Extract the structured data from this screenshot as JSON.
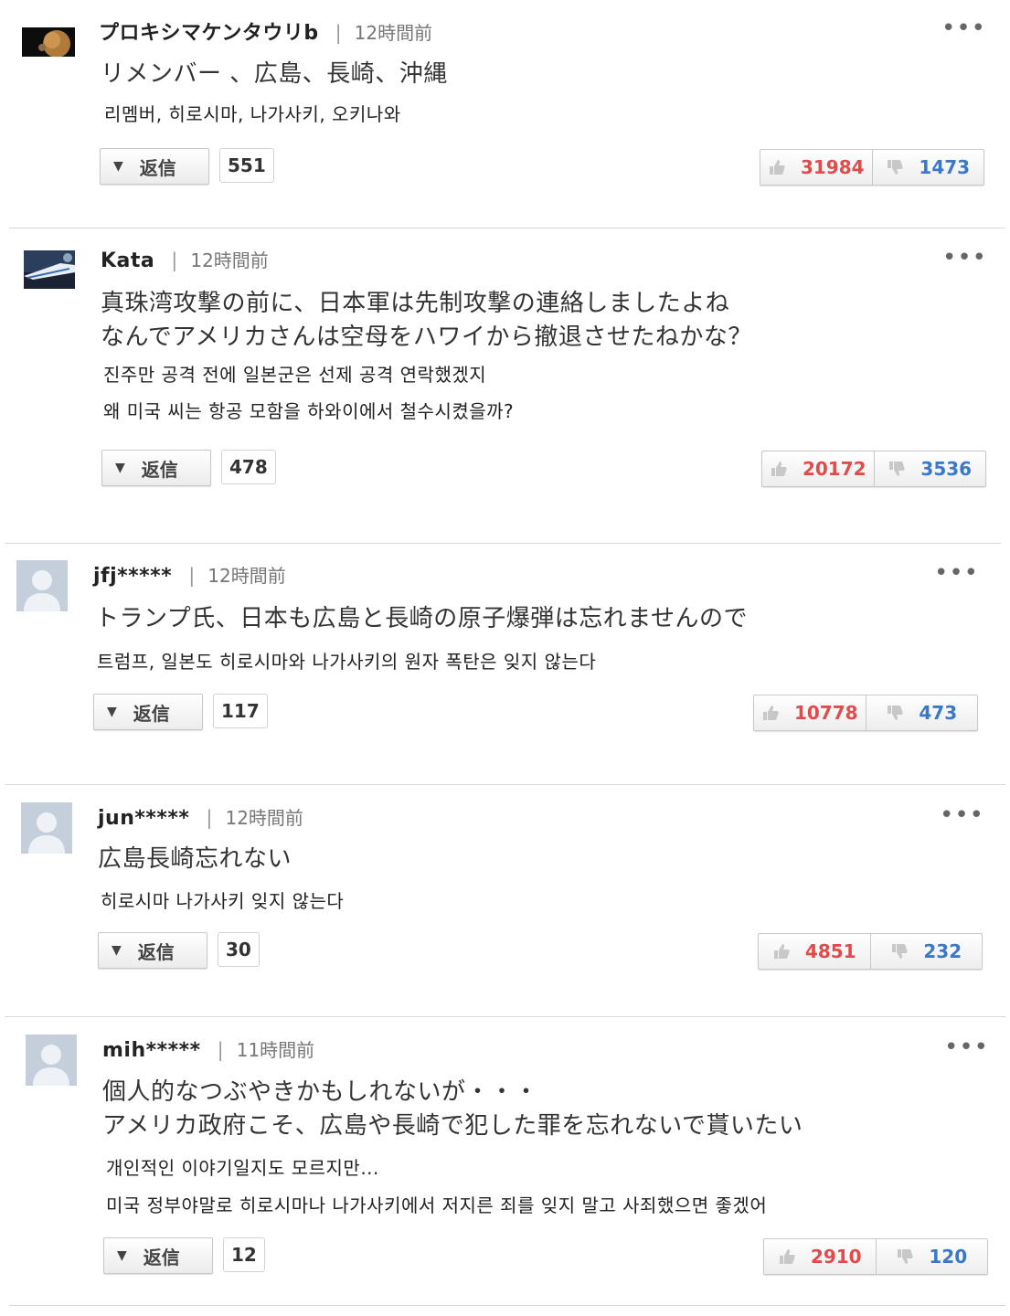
{
  "reply_label": "返信",
  "colors": {
    "like": "#e14b4b",
    "dislike": "#3a78c8",
    "divider": "#d8d8d8"
  },
  "comments": [
    {
      "username": "プロキシマケンタウリb",
      "time": "12時間前",
      "avatar_icon": "planet-avatar-icon",
      "text_jp": [
        "リメンバー 、広島、長崎、沖縄"
      ],
      "text_ko": [
        "리멤버, 히로시마, 나가사키, 오키나와"
      ],
      "reply_count": "551",
      "likes": "31984",
      "dislikes": "1473"
    },
    {
      "username": "Kata",
      "time": "12時間前",
      "avatar_icon": "train-avatar-icon",
      "text_jp": [
        "真珠湾攻撃の前に、日本軍は先制攻撃の連絡しましたよね",
        "なんでアメリカさんは空母をハワイから撤退させたねかな？"
      ],
      "text_ko": [
        "진주만 공격 전에 일본군은 선제 공격 연락했겠지",
        "왜 미국 씨는 항공 모함을 하와이에서 철수시켰을까?"
      ],
      "reply_count": "478",
      "likes": "20172",
      "dislikes": "3536"
    },
    {
      "username": "jfj*****",
      "time": "12時間前",
      "avatar_icon": "default-user-avatar-icon",
      "text_jp": [
        "トランプ氏、日本も広島と長崎の原子爆弾は忘れませんので"
      ],
      "text_ko": [
        "트럼프, 일본도 히로시마와 나가사키의 원자 폭탄은 잊지 않는다"
      ],
      "reply_count": "117",
      "likes": "10778",
      "dislikes": "473"
    },
    {
      "username": "jun*****",
      "time": "12時間前",
      "avatar_icon": "default-user-avatar-icon",
      "text_jp": [
        "広島長崎忘れない"
      ],
      "text_ko": [
        "히로시마 나가사키 잊지 않는다"
      ],
      "reply_count": "30",
      "likes": "4851",
      "dislikes": "232"
    },
    {
      "username": "mih*****",
      "time": "11時間前",
      "avatar_icon": "default-user-avatar-icon",
      "text_jp": [
        "個人的なつぶやきかもしれないが・・・",
        "アメリカ政府こそ、広島や長崎で犯した罪を忘れないで貰いたい"
      ],
      "text_ko": [
        "개인적인 이야기일지도 모르지만...",
        "미국 정부야말로 히로시마나 나가사키에서 저지른 죄를 잊지 말고 사죄했으면 좋겠어"
      ],
      "reply_count": "12",
      "likes": "2910",
      "dislikes": "120"
    }
  ]
}
